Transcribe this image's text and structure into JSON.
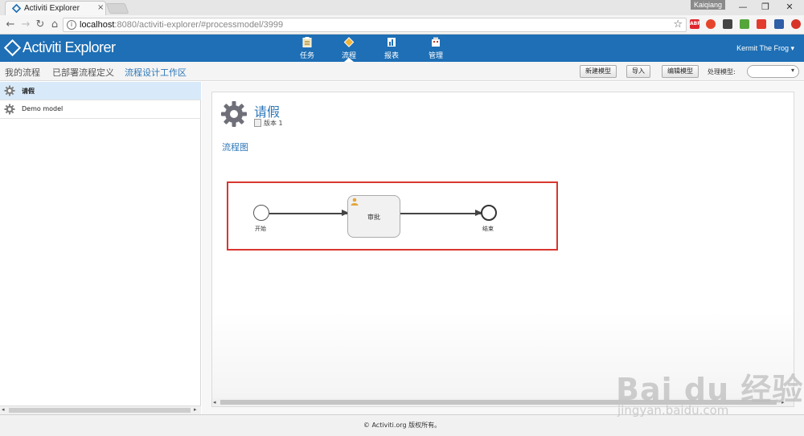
{
  "browser": {
    "tab_title": "Activiti Explorer",
    "tab_close": "×",
    "user_badge": "Kaiqiang",
    "minimize": "—",
    "restore": "❐",
    "close": "✕",
    "url_host": "localhost",
    "url_rest": ":8080/activiti-explorer/#processmodel/3999",
    "extensions": [
      {
        "name": "ABP",
        "color": "#e0262d"
      },
      {
        "name": "",
        "color": "#e6452c"
      },
      {
        "name": "",
        "color": "#444444"
      },
      {
        "name": "",
        "color": "#54a63b"
      },
      {
        "name": "",
        "color": "#e33b2e"
      },
      {
        "name": "",
        "color": "#2e5ea6"
      },
      {
        "name": "",
        "color": "#d7332b"
      }
    ]
  },
  "app": {
    "logo_text": "Activiti Explorer",
    "nav": [
      {
        "label": "任务",
        "icon": "clipboard-icon"
      },
      {
        "label": "流程",
        "icon": "diamond-icon",
        "active": true
      },
      {
        "label": "报表",
        "icon": "report-icon"
      },
      {
        "label": "管理",
        "icon": "management-icon"
      }
    ],
    "user": "Kermit The Frog ▾"
  },
  "subnav": {
    "links": [
      "我的流程",
      "已部署流程定义",
      "流程设计工作区"
    ],
    "active_index": 2,
    "buttons": [
      "新建模型",
      "导入",
      "编辑模型"
    ],
    "action_label": "处理模型:"
  },
  "models": [
    {
      "name": "请假",
      "selected": true
    },
    {
      "name": "Demo model",
      "selected": false
    }
  ],
  "detail": {
    "title": "请假",
    "version": "版本 1",
    "section": "流程图",
    "diagram": {
      "start_label": "开始",
      "task_label": "审批",
      "end_label": "结束",
      "highlight_color": "#d9362f"
    }
  },
  "footer": {
    "text": "© Activiti.org 版权所有。"
  },
  "watermark": {
    "text": "Bai du 经验",
    "url": "jingyan.baidu.com"
  }
}
